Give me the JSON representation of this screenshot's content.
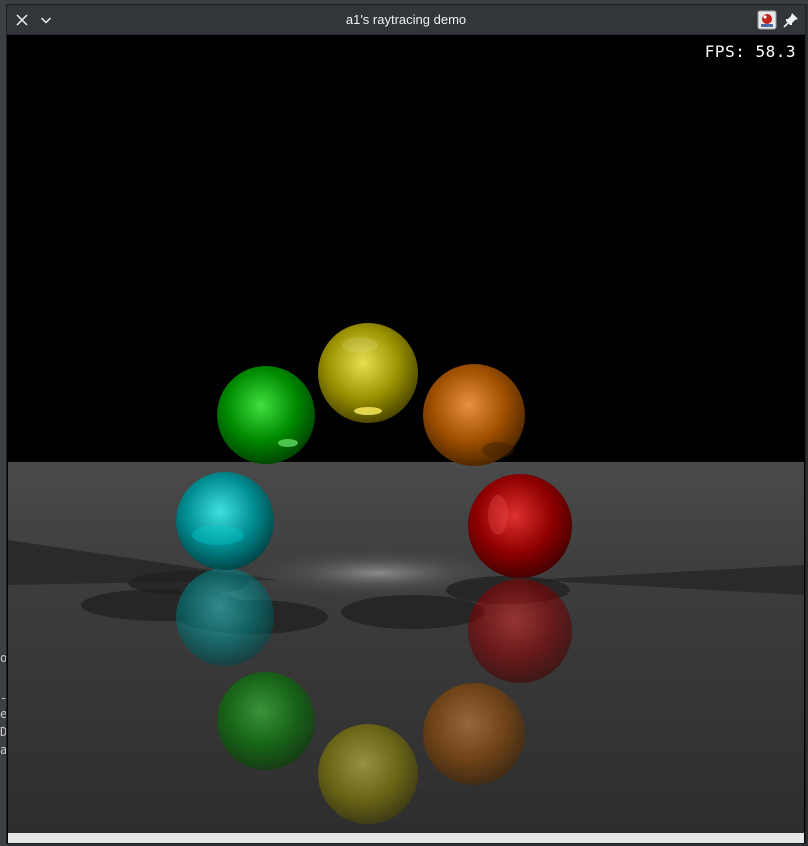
{
  "window": {
    "title": "a1's raytracing demo",
    "fps_label": "FPS: 58.3"
  },
  "background_terminal": {
    "left_chars": [
      "o",
      "",
      "-",
      "e",
      "D",
      "a"
    ]
  },
  "icons": {
    "close": "close-icon",
    "menu": "chevron-down-icon",
    "app": "app-icon",
    "pin": "pin-icon"
  },
  "scene": {
    "spheres": [
      {
        "name": "yellow",
        "color": "#d8d000"
      },
      {
        "name": "orange",
        "color": "#d87000"
      },
      {
        "name": "red",
        "color": "#d00000"
      },
      {
        "name": "cyan",
        "color": "#00c8c8"
      },
      {
        "name": "green",
        "color": "#00c000"
      }
    ]
  }
}
